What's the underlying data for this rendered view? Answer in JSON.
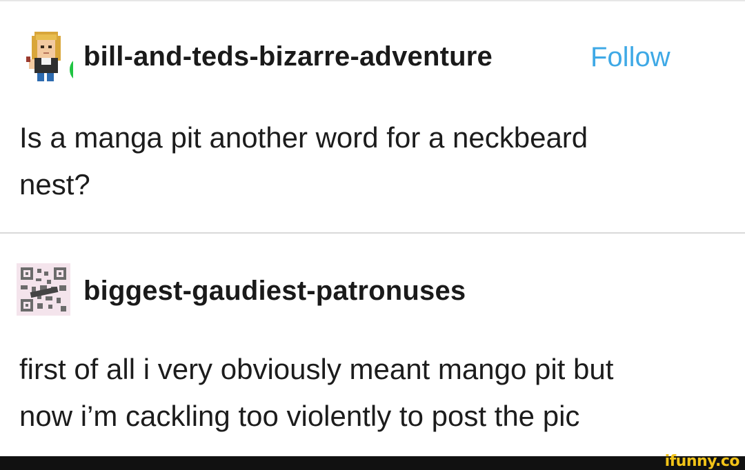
{
  "posts": [
    {
      "blog_name": "bill-and-teds-bizarre-adventure",
      "follow_label": "Follow",
      "body_lines": [
        "Is a manga pit another word for a neckbeard",
        "nest?"
      ],
      "avatar_icon": "pixel-character-avatar",
      "badge_icon": "reblog-icon",
      "badge_color": "#1fc442"
    },
    {
      "blog_name": "biggest-gaudiest-patronuses",
      "body_lines": [
        "first of all i very obviously meant mango pit but",
        "now i’m cackling too violently to post the pic"
      ],
      "avatar_icon": "qr-code-avatar"
    }
  ],
  "watermark": "ifunny.co",
  "colors": {
    "link": "#3fa9e6",
    "text": "#1c1c1c",
    "divider": "#d9d9d9",
    "footer": "#111111",
    "watermark": "#f2c318"
  }
}
